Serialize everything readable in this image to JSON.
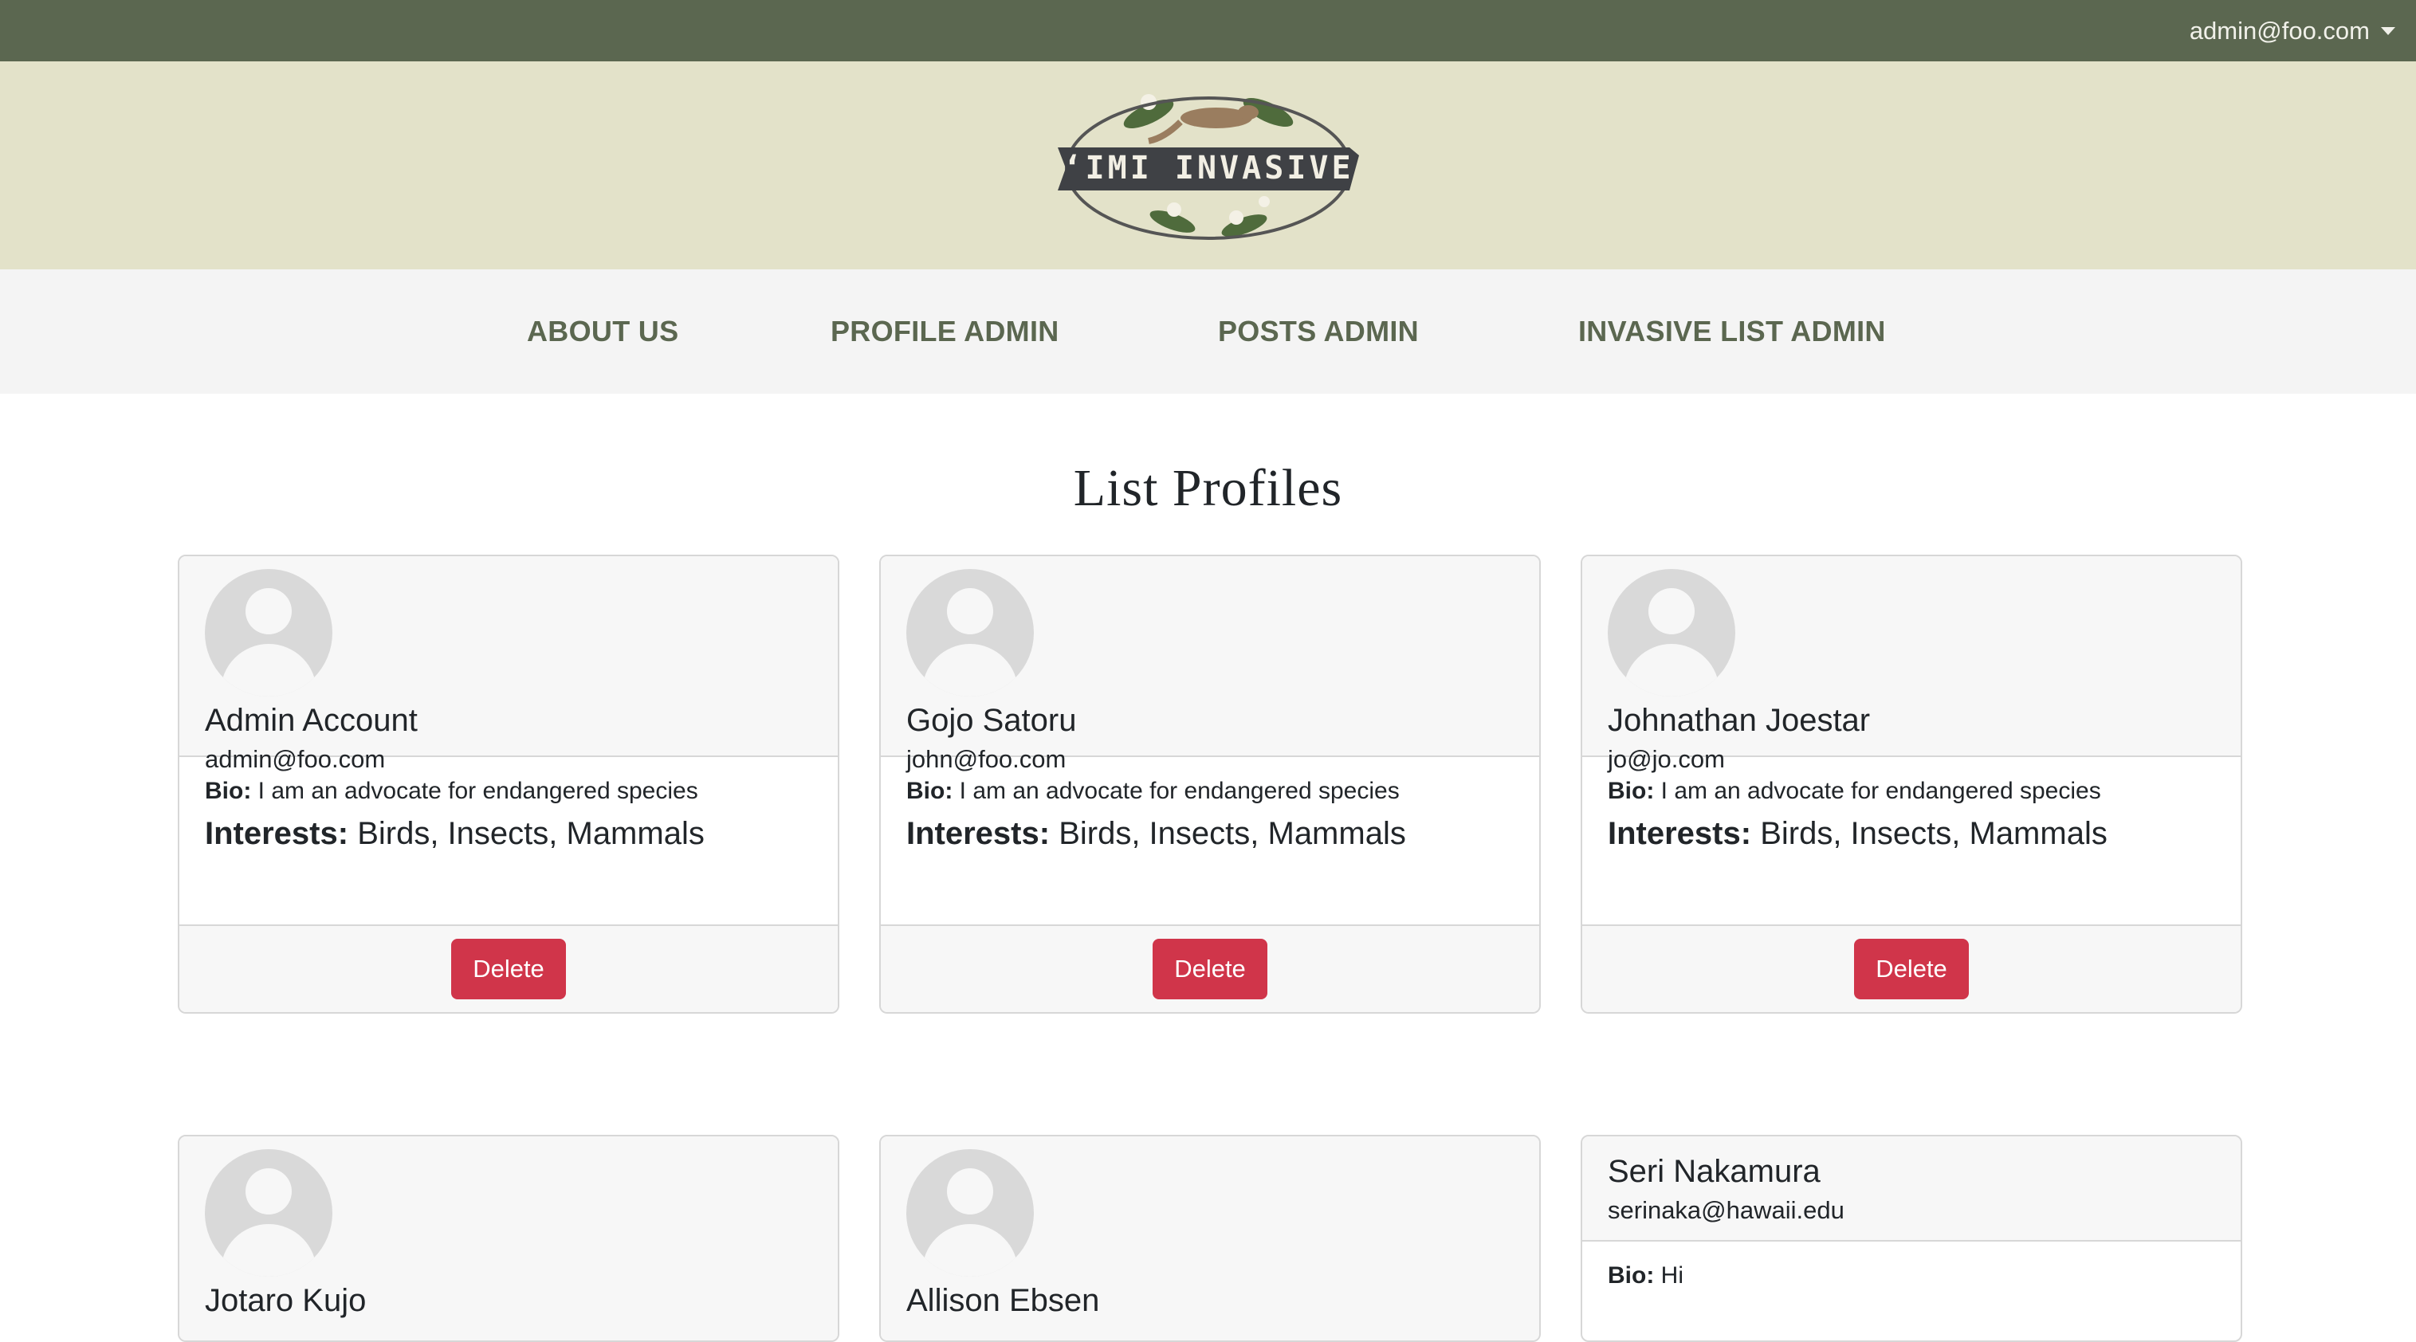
{
  "topbar": {
    "user_label": "admin@foo.com"
  },
  "banner": {
    "logo_text": "‘IMI INVASIVE"
  },
  "nav": {
    "items": [
      {
        "label": "ABOUT US"
      },
      {
        "label": "PROFILE ADMIN"
      },
      {
        "label": "POSTS ADMIN"
      },
      {
        "label": "INVASIVE LIST ADMIN"
      }
    ]
  },
  "page": {
    "title": "List Profiles"
  },
  "labels": {
    "bio": "Bio:",
    "interests": "Interests:",
    "delete": "Delete"
  },
  "profiles": [
    {
      "name": "Admin Account",
      "email": "admin@foo.com",
      "bio": "I am an advocate for endangered species",
      "interests": "Birds, Insects, Mammals"
    },
    {
      "name": "Gojo Satoru",
      "email": "john@foo.com",
      "bio": "I am an advocate for endangered species",
      "interests": "Birds, Insects, Mammals"
    },
    {
      "name": "Johnathan Joestar",
      "email": "jo@jo.com",
      "bio": "I am an advocate for endangered species",
      "interests": "Birds, Insects, Mammals"
    },
    {
      "name": "Jotaro Kujo"
    },
    {
      "name": "Allison Ebsen"
    },
    {
      "name": "Seri Nakamura",
      "email": "serinaka@hawaii.edu",
      "bio": "Hi"
    }
  ],
  "colors": {
    "topbar": "#5b6750",
    "banner": "#e3e2c9",
    "nav_text": "#5b6750",
    "delete_button": "#d0354a"
  }
}
